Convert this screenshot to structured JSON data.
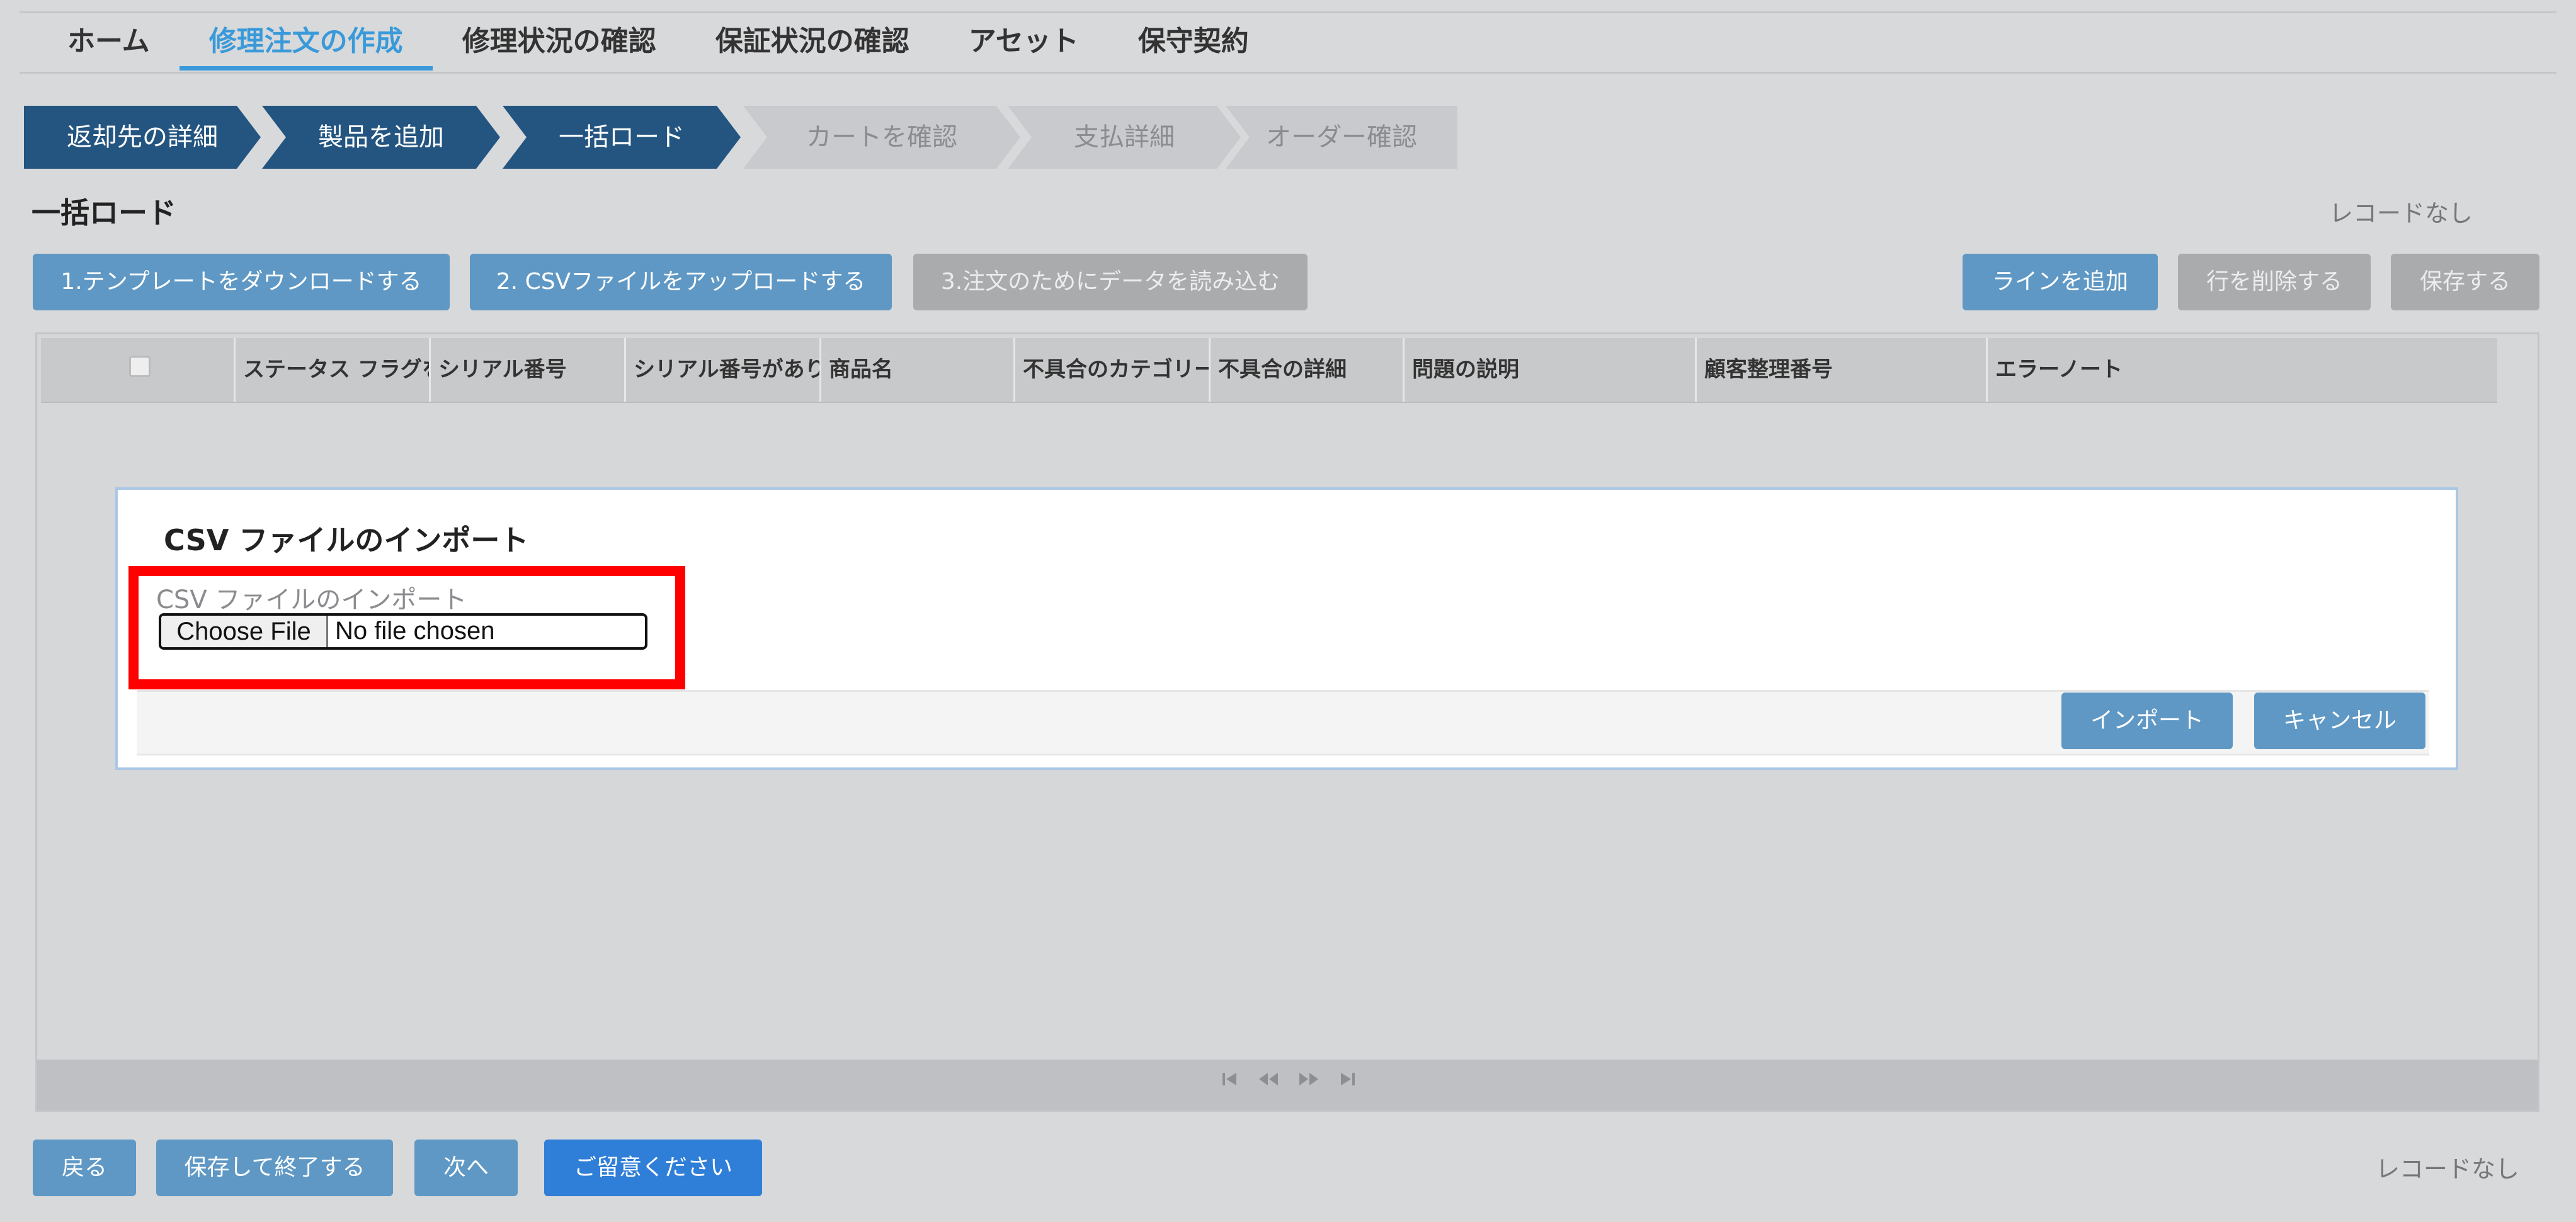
{
  "nav": {
    "items": [
      {
        "label": "ホーム"
      },
      {
        "label": "修理注文の作成"
      },
      {
        "label": "修理状況の確認"
      },
      {
        "label": "保証状況の確認"
      },
      {
        "label": "アセット"
      },
      {
        "label": "保守契約"
      }
    ]
  },
  "stepper": {
    "steps": [
      {
        "label": "返却先の詳細"
      },
      {
        "label": "製品を追加"
      },
      {
        "label": "一括ロード"
      },
      {
        "label": "カートを確認"
      },
      {
        "label": "支払詳細"
      },
      {
        "label": "オーダー確認"
      }
    ]
  },
  "section": {
    "title": "一括ロード",
    "record_status": "レコードなし"
  },
  "toolbar": {
    "download_template": "1.テンプレートをダウンロードする",
    "upload_csv": "2. CSVファイルをアップロードする",
    "load_data": "3.注文のためにデータを読み込む",
    "add_line": "ラインを追加",
    "delete_row": "行を削除する",
    "save": "保存する"
  },
  "grid": {
    "columns": [
      {
        "label": "ステータス フラグを"
      },
      {
        "label": "シリアル番号"
      },
      {
        "label": "シリアル番号がありま"
      },
      {
        "label": "商品名"
      },
      {
        "label": "不具合のカテゴリー"
      },
      {
        "label": "不具合の詳細"
      },
      {
        "label": "問題の説明"
      },
      {
        "label": "顧客整理番号"
      },
      {
        "label": "エラーノート"
      }
    ],
    "pager_icons": [
      "first-page-icon",
      "prev-page-icon",
      "next-page-icon",
      "last-page-icon"
    ]
  },
  "modal": {
    "title": "CSV ファイルのインポート",
    "field_label": "CSV ファイルのインポート",
    "choose_file": "Choose File",
    "no_file": "No file chosen",
    "import_button": "インポート",
    "cancel_button": "キャンセル"
  },
  "footer": {
    "back": "戻る",
    "save_exit": "保存して終了する",
    "next": "次へ",
    "notice": "ご留意ください",
    "record_status": "レコードなし"
  },
  "colors": {
    "accent": "#3a9ad9",
    "step_done": "#245580",
    "button_blue": "#5f98c4",
    "button_primary": "#2f7ed8",
    "highlight": "#ff0000"
  }
}
